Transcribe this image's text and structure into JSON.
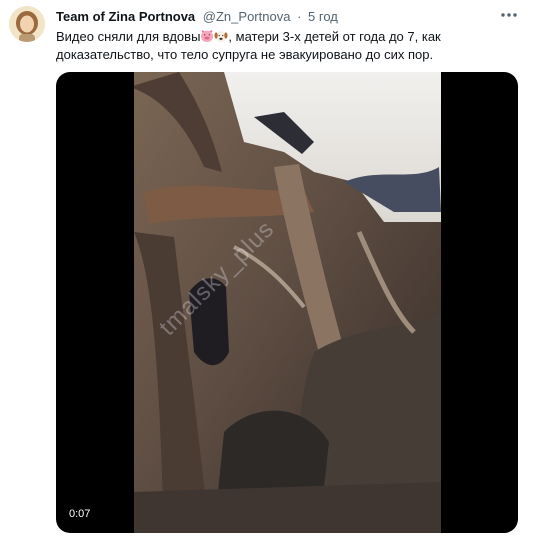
{
  "tweet": {
    "author": {
      "display_name": "Team of Zina Portnova",
      "handle": "@Zn_Portnova",
      "separator": "·",
      "time": "5 год"
    },
    "text": {
      "part1": "Видео сняли для вдовы",
      "emoji1": "pig-face-emoji",
      "emoji2": "dog-face-emoji",
      "part2": ", матери 3-х детей от года до 7, как доказательство, что тело супруга не эвакуировано до сих пор."
    },
    "media": {
      "type": "video",
      "watermark": "tmalsky_plus",
      "duration": "0:07"
    },
    "icons": {
      "more": "more-icon"
    },
    "colors": {
      "text": "#0f1419",
      "secondary": "#536471",
      "media_background": "#000000"
    }
  }
}
